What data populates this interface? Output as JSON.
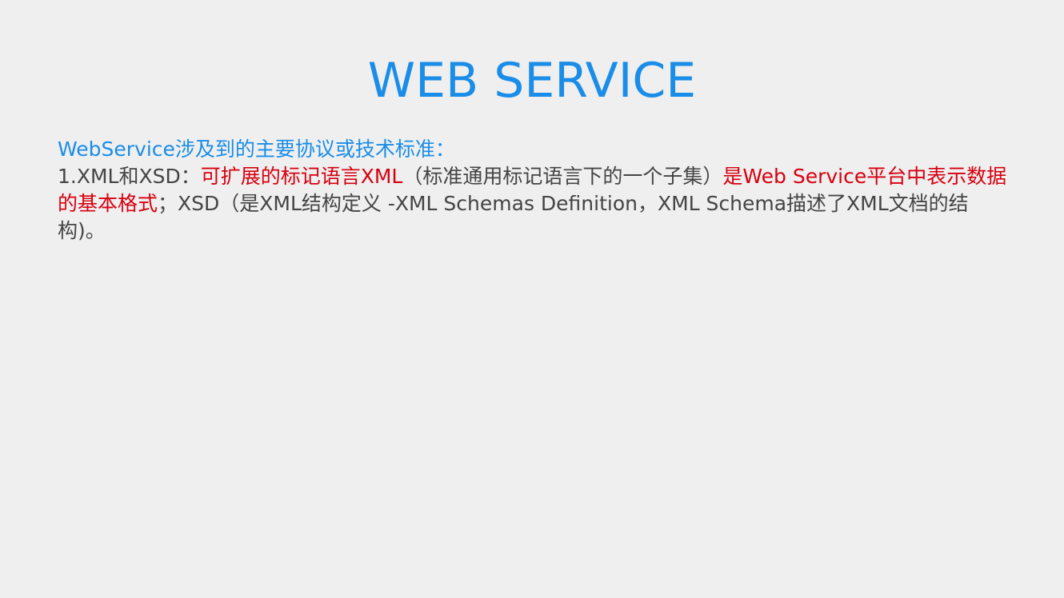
{
  "slide": {
    "title": "WEB SERVICE",
    "intro": "WebService涉及到的主要协议或技术标准：",
    "item1": {
      "prefix": "1.XML和XSD：",
      "highlight1": "可扩展的标记语言XML",
      "middle": "（标准通用标记语言下的一个子集）",
      "highlight2": "是Web Service平台中表示数据的基本格式",
      "suffix": "；XSD（是XML结构定义 -XML Schemas Definition，XML Schema描述了XML文档的结构)。"
    }
  },
  "colors": {
    "background": "#efefef",
    "title": "#1a8de8",
    "intro": "#1a8de8",
    "body_text": "#444444",
    "highlight": "#d7000f"
  }
}
